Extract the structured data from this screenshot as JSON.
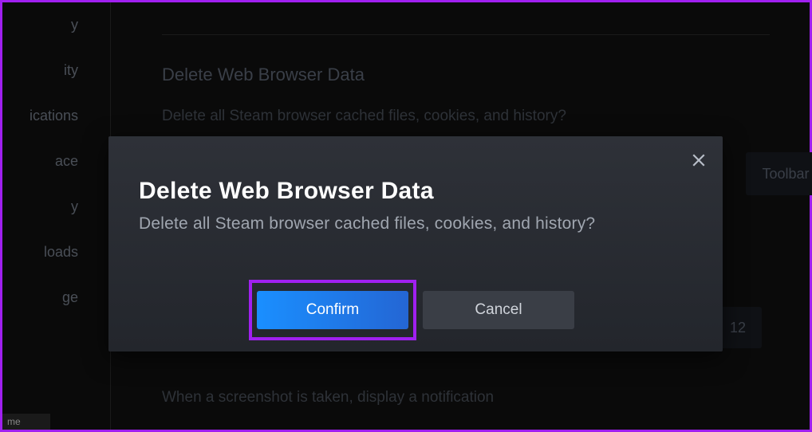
{
  "sidebar": {
    "items": [
      {
        "label": "y"
      },
      {
        "label": "ity"
      },
      {
        "label": "ications"
      },
      {
        "label": "ace"
      },
      {
        "label": "y"
      },
      {
        "label": "loads"
      },
      {
        "label": "ge"
      }
    ]
  },
  "background": {
    "section_title": "Delete Web Browser Data",
    "section_sub": "Delete all Steam browser cached files, cookies, and history?",
    "toolbar_label": "Toolbar",
    "value_box": "12",
    "footer_text": "When a screenshot is taken, display a notification",
    "bottom_bar": "me"
  },
  "modal": {
    "title": "Delete Web Browser Data",
    "subtitle": "Delete all Steam browser cached files, cookies, and history?",
    "confirm_label": "Confirm",
    "cancel_label": "Cancel"
  }
}
